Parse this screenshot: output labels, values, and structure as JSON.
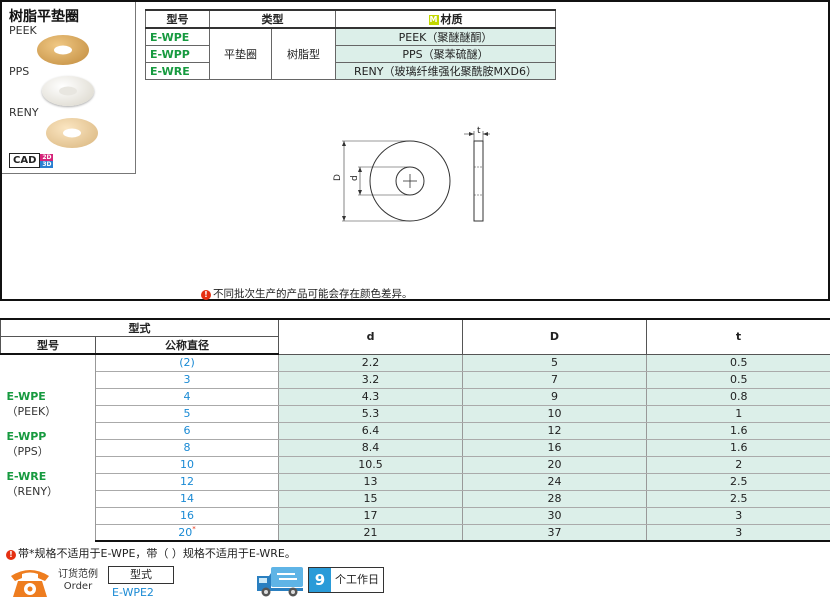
{
  "product": {
    "title": "树脂平垫圈",
    "materials": [
      "PEEK",
      "PPS",
      "RENY"
    ],
    "cad_label": "CAD",
    "cad_2d": "2D",
    "cad_3d": "3D"
  },
  "spec_table": {
    "headers": {
      "code": "型号",
      "type": "类型",
      "material_badge": "M",
      "material": "材质"
    },
    "type_values": [
      "平垫圈",
      "树脂型"
    ],
    "rows": [
      {
        "code": "E-WPE",
        "material": "PEEK（聚醚醚酮）"
      },
      {
        "code": "E-WPP",
        "material": "PPS（聚苯硫醚）"
      },
      {
        "code": "E-WRE",
        "material": "RENY（玻璃纤维强化聚酰胺MXD6）"
      }
    ]
  },
  "drawing": {
    "label_D": "D",
    "label_d": "d",
    "label_t": "t"
  },
  "top_note": "不同批次生产的产品可能会存在颜色差异。",
  "size_table": {
    "header_group": "型式",
    "header_code": "型号",
    "header_nominal": "公称直径",
    "header_d": "d",
    "header_D": "D",
    "header_t": "t",
    "series": [
      {
        "code": "E-WPE",
        "material": "（PEEK）"
      },
      {
        "code": "E-WPP",
        "material": "（PPS）"
      },
      {
        "code": "E-WRE",
        "material": "（RENY）"
      }
    ],
    "rows": [
      {
        "nominal": "(2)",
        "d": "2.2",
        "D": "5",
        "t": "0.5"
      },
      {
        "nominal": "3",
        "d": "3.2",
        "D": "7",
        "t": "0.5"
      },
      {
        "nominal": "4",
        "d": "4.3",
        "D": "9",
        "t": "0.8"
      },
      {
        "nominal": "5",
        "d": "5.3",
        "D": "10",
        "t": "1"
      },
      {
        "nominal": "6",
        "d": "6.4",
        "D": "12",
        "t": "1.6"
      },
      {
        "nominal": "8",
        "d": "8.4",
        "D": "16",
        "t": "1.6"
      },
      {
        "nominal": "10",
        "d": "10.5",
        "D": "20",
        "t": "2"
      },
      {
        "nominal": "12",
        "d": "13",
        "D": "24",
        "t": "2.5"
      },
      {
        "nominal": "14",
        "d": "15",
        "D": "28",
        "t": "2.5"
      },
      {
        "nominal": "16",
        "d": "17",
        "D": "30",
        "t": "3"
      },
      {
        "nominal": "20",
        "d": "21",
        "D": "37",
        "t": "3",
        "star": "*"
      }
    ]
  },
  "bottom_note": "带*规格不适用于E-WPE，带（ ）规格不适用于E-WRE。",
  "order": {
    "label_cn": "订货范例",
    "label_en": "Order",
    "box_label": "型式",
    "example": "E-WPE2"
  },
  "delivery": {
    "days": "9",
    "unit": "个工作日"
  },
  "colors": {
    "accent_green": "#169a3f",
    "accent_blue": "#1a8ad4",
    "cell_tint": "#dcefe9",
    "warn": "#e53012"
  }
}
